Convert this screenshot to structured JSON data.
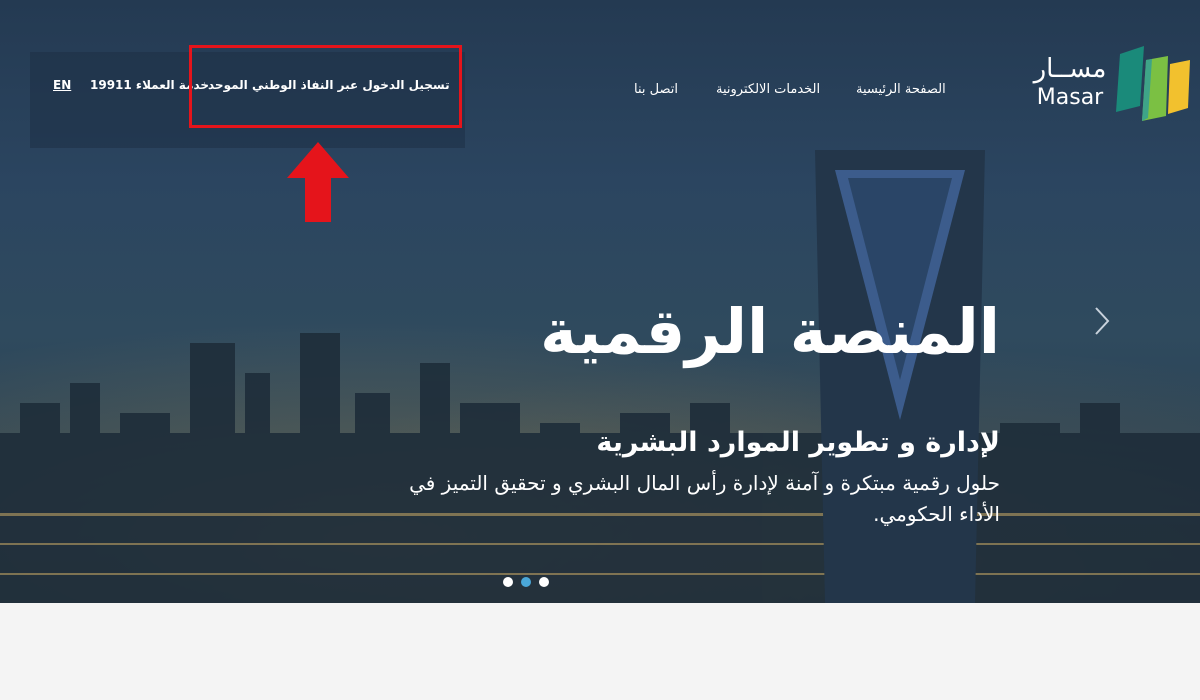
{
  "header": {
    "utility": {
      "language_label": "EN",
      "support_label": "خدمة العملاء 19911",
      "login_label": "تسجيل الدخول عبر النفاذ الوطني الموحد"
    },
    "nav": {
      "home": "الصفحة الرئيسية",
      "services": "الخدمات الالكترونية",
      "contact": "اتصل بنا"
    },
    "logo": {
      "arabic": "مســار",
      "english": "Masar"
    }
  },
  "hero": {
    "title": "المنصة الرقمية",
    "subtitle": "لإدارة و تطوير الموارد البشرية",
    "description": "حلول رقمية مبتكرة و آمنة لإدارة رأس المال البشري و تحقيق التميز في الأداء الحكومي.",
    "slide_count": 3,
    "active_slide": 2
  },
  "colors": {
    "highlight": "#e5141b",
    "logo_teal": "#1a8a7a",
    "logo_green": "#7bc043",
    "logo_yellow": "#f2c12e",
    "dot_active": "#4aa7d8"
  },
  "icons": {
    "next": "chevron-right-icon",
    "annotation": "arrow-up-icon"
  }
}
